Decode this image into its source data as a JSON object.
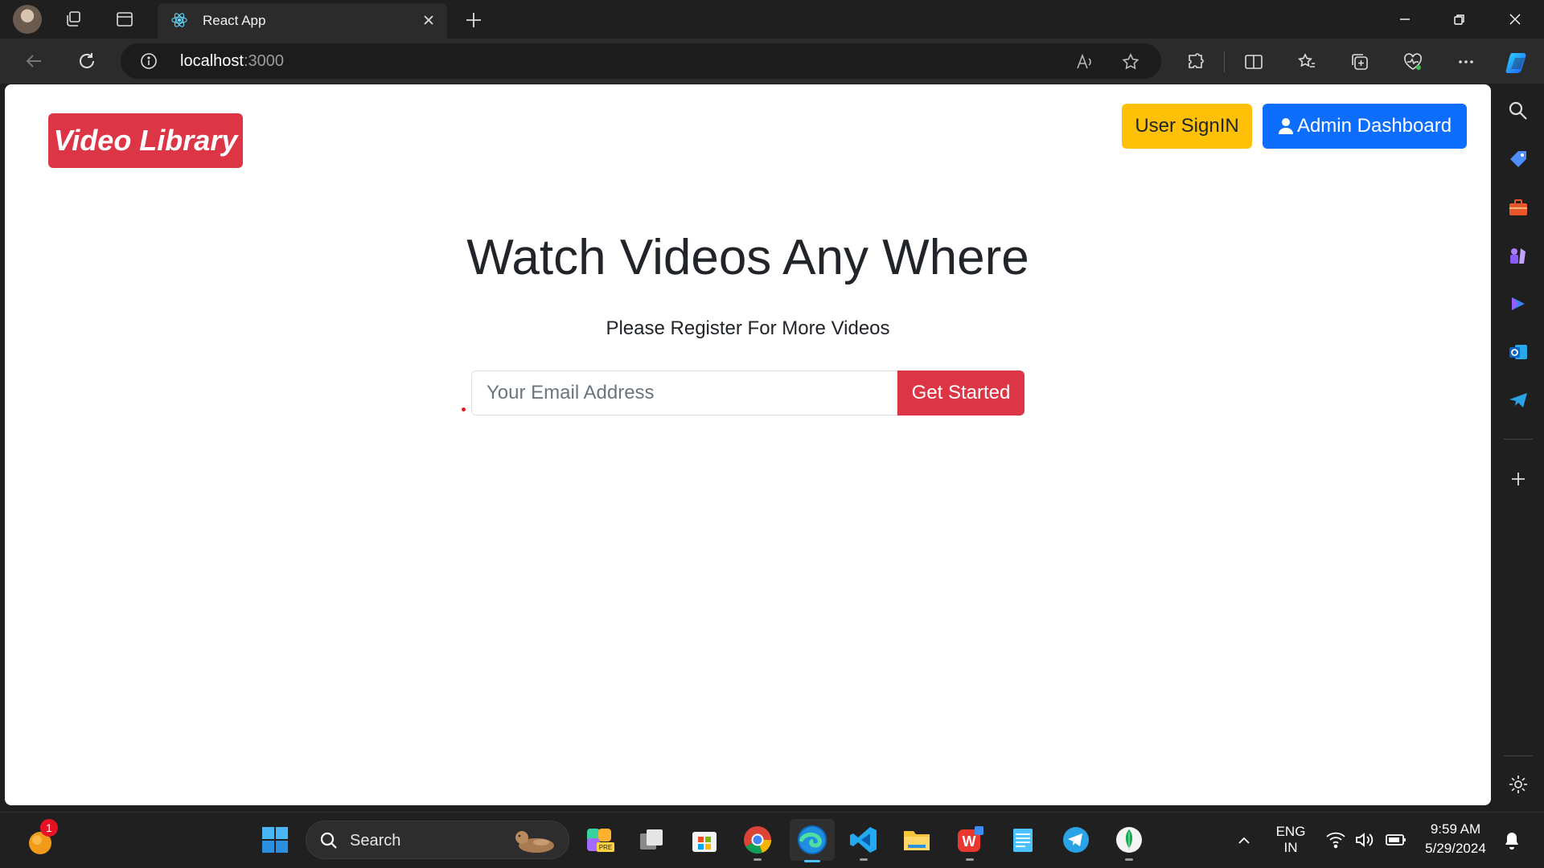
{
  "browser": {
    "tab_title": "React App",
    "url_host": "localhost",
    "url_port": ":3000"
  },
  "page": {
    "brand": "Video Library",
    "nav": {
      "user_signin": "User SignIN",
      "admin_dashboard": "Admin Dashboard"
    },
    "hero": {
      "title": "Watch Videos Any Where",
      "subtitle": "Please Register For More Videos",
      "email_placeholder": "Your Email Address",
      "cta": "Get Started"
    }
  },
  "taskbar": {
    "search_label": "Search",
    "notification_count": "1",
    "language_top": "ENG",
    "language_bottom": "IN",
    "time": "9:59 AM",
    "date": "5/29/2024"
  },
  "colors": {
    "danger": "#dc3545",
    "warning": "#ffc107",
    "primary": "#0d6efd",
    "browser_dark": "#1f1f1f"
  }
}
